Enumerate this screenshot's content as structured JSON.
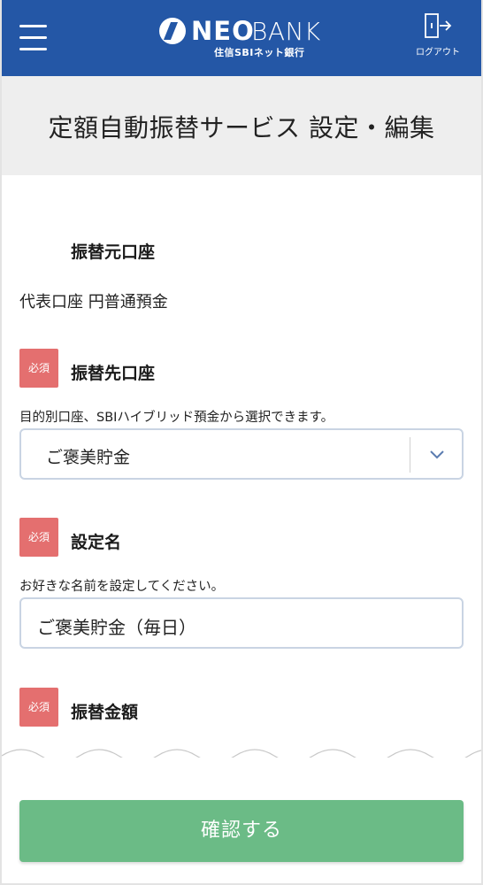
{
  "header": {
    "logo_neo": "NEO",
    "logo_bank": "BANK",
    "logo_sub": "住信SBIネット銀行",
    "logout_label": "ログアウト",
    "menu_icon": "hamburger-icon",
    "logout_icon": "logout-door-icon"
  },
  "page": {
    "title": "定額自動振替サービス 設定・編集"
  },
  "from_account": {
    "label": "振替元口座",
    "value": "代表口座 円普通預金"
  },
  "to_account": {
    "badge": "必須",
    "label": "振替先口座",
    "hint": "目的別口座、SBIハイブリッド預金から選択できます。",
    "selected": "ご褒美貯金"
  },
  "setting_name": {
    "badge": "必須",
    "label": "設定名",
    "hint": "お好きな名前を設定してください。",
    "value": "ご褒美貯金（毎日）"
  },
  "amount": {
    "badge": "必須",
    "label": "振替金額"
  },
  "footer": {
    "confirm_label": "確認する"
  },
  "colors": {
    "header_bg": "#2457a6",
    "required_badge": "#e46f6f",
    "confirm_button": "#6bbb86",
    "title_band": "#eeeeee"
  }
}
